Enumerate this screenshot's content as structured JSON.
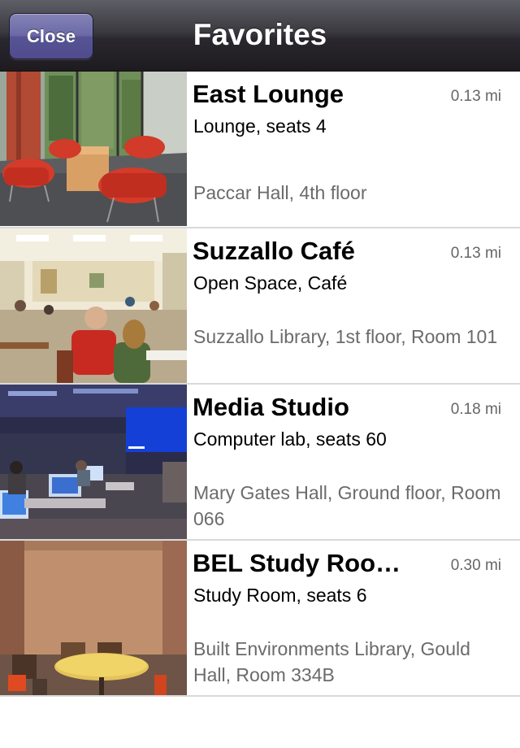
{
  "navbar": {
    "title": "Favorites",
    "close_label": "Close"
  },
  "favorites": [
    {
      "name": "East Lounge",
      "distance": "0.13 mi",
      "type": "Lounge, seats 4",
      "location": "Paccar Hall, 4th floor"
    },
    {
      "name": "Suzzallo Café",
      "distance": "0.13 mi",
      "type": "Open Space, Café",
      "location": "Suzzallo Library, 1st floor, Room 101"
    },
    {
      "name": "Media Studio",
      "distance": "0.18 mi",
      "type": "Computer lab, seats 60",
      "location": "Mary Gates Hall, Ground floor, Room 066"
    },
    {
      "name": "BEL Study Roo…",
      "distance": "0.30 mi",
      "type": "Study Room, seats 6",
      "location": "Built Environments Library, Gould Hall, Room 334B"
    }
  ]
}
